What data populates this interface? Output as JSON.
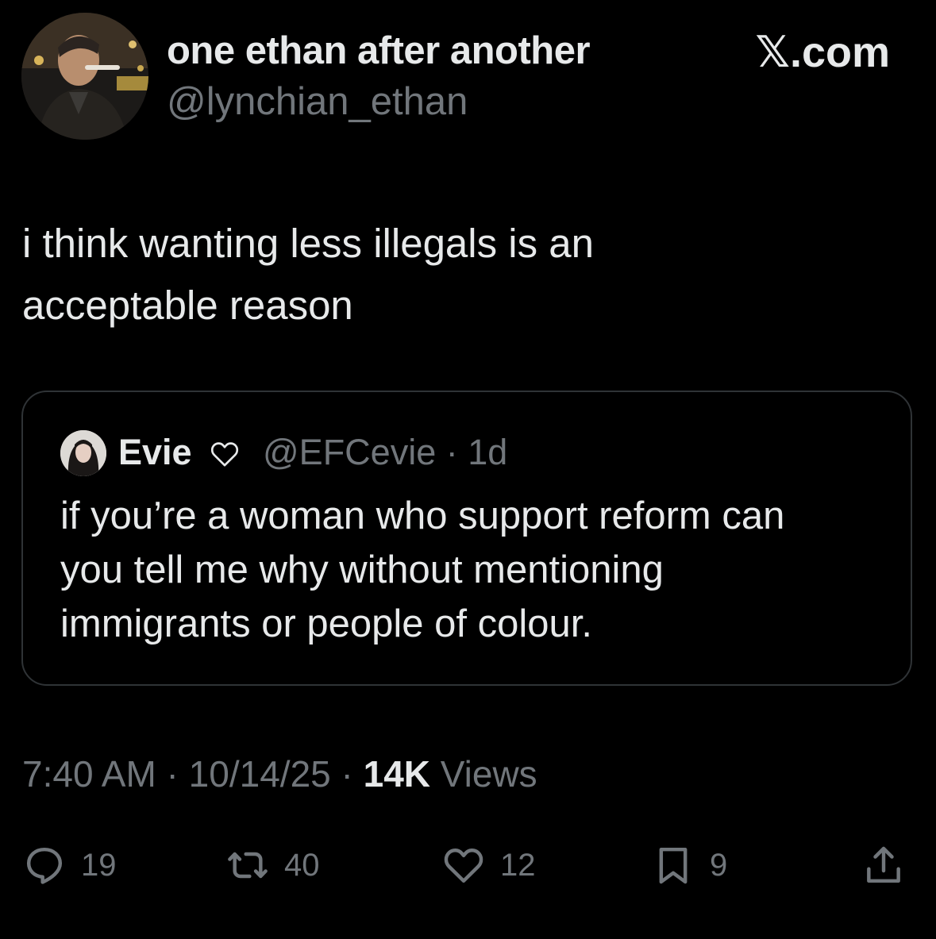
{
  "author": {
    "display_name": "one ethan after another",
    "handle": "@lynchian_ethan",
    "avatar_icon": "profile-photo"
  },
  "brand": "𝕏.com",
  "tweet": {
    "text": "i think wanting less illegals is an\nacceptable reason"
  },
  "quoted": {
    "display_name": "Evie",
    "name_emoji_icon": "white-heart-icon",
    "handle_time": "@EFCevie · 1d",
    "text": "if you’re a woman who support reform can\nyou tell me why without mentioning\nimmigrants or people of colour."
  },
  "meta": {
    "time": "7:40 AM",
    "date": "10/14/25",
    "views_count": "14K",
    "views_label": "Views",
    "separator": " · "
  },
  "actions": {
    "replies": "19",
    "reposts": "40",
    "likes": "12",
    "bookmarks": "9"
  },
  "colors": {
    "background": "#000000",
    "primary_text": "#e7e9ea",
    "secondary_text": "#71767b",
    "border": "#2f3336"
  }
}
